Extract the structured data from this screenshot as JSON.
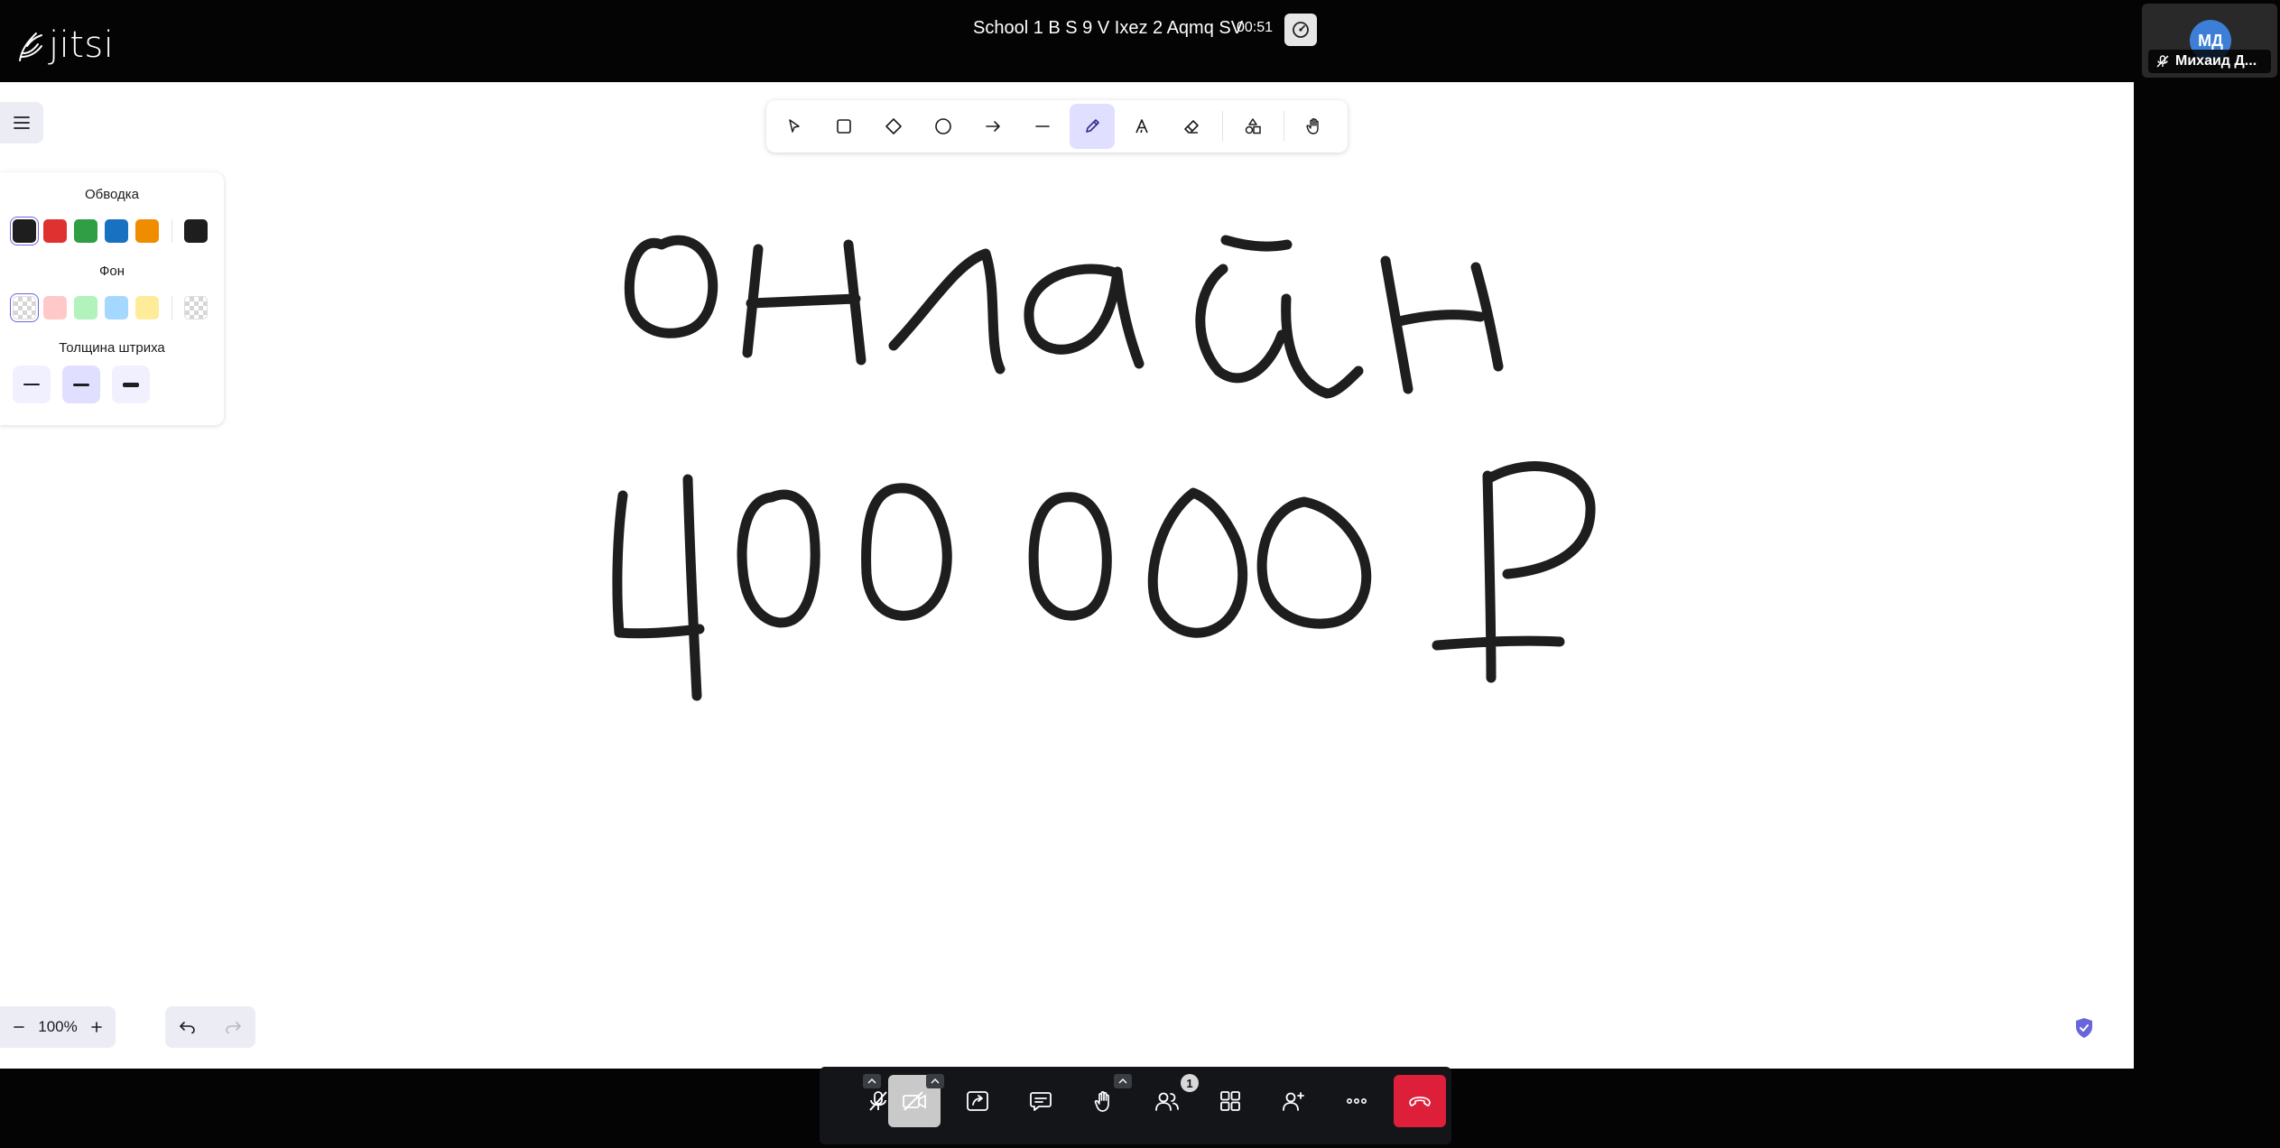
{
  "app": {
    "logo_text": "jitsi",
    "meeting_title": "School 1 B S 9 V Ixez 2 Aqmq SV",
    "timer": "00:51"
  },
  "participant": {
    "initials": "МД",
    "name": "Михаид Д..."
  },
  "whiteboard": {
    "properties": {
      "stroke_title": "Обводка",
      "background_title": "Фон",
      "stroke_width_title": "Толщина штриха",
      "stroke_colors": [
        "#1e1e1e",
        "#e03131",
        "#2f9e44",
        "#1971c2",
        "#f08c00"
      ],
      "current_stroke_color": "#1e1e1e",
      "background_colors": [
        "transparent",
        "#ffc9c9",
        "#b2f2bb",
        "#a5d8ff",
        "#ffec99"
      ],
      "current_background": "transparent",
      "selected_stroke_width": "medium"
    },
    "active_tool": "pencil",
    "zoom_level": "100%",
    "drawing_text": [
      "онлайн",
      "400 000 ₽"
    ]
  },
  "colors": {
    "accent": "#6965db",
    "accent_light": "#e0dfff",
    "hangup": "#dd1f3a",
    "avatar": "#3d7fd6"
  },
  "participants_count": "1"
}
